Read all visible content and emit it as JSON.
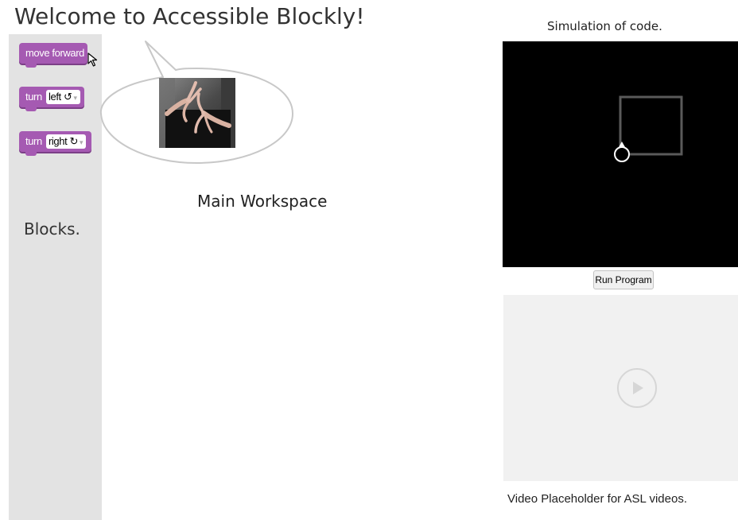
{
  "header": {
    "title": "Welcome to Accessible Blockly!"
  },
  "toolbox": {
    "label": "Blocks.",
    "blocks": [
      {
        "text": "move forward"
      },
      {
        "text": "turn",
        "dropdown": "left ↺",
        "dropdown_arrow": "▾"
      },
      {
        "text": "turn",
        "dropdown": "right ↻",
        "dropdown_arrow": "▾"
      }
    ]
  },
  "workspace": {
    "label": "Main Workspace"
  },
  "simulation": {
    "title": "Simulation of code.",
    "run_button": "Run Program"
  },
  "video": {
    "caption": "Video Placeholder for ASL videos."
  },
  "colors": {
    "block": "#a55ab2",
    "toolbox_bg": "#e3e3e3",
    "canvas_bg": "#000000",
    "video_bg": "#f1f1f1"
  },
  "icons": {
    "cursor": "cursor-icon",
    "play": "play-icon",
    "robot": "robot-icon"
  }
}
